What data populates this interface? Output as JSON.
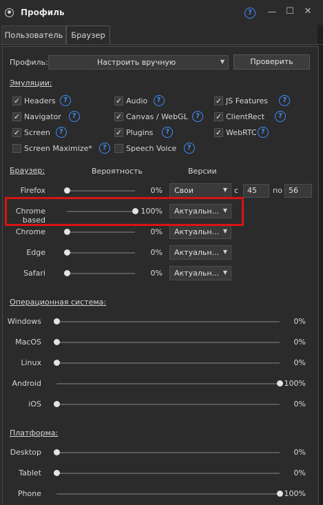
{
  "window": {
    "title": "Профиль",
    "help_icon": "help-icon"
  },
  "tabs": [
    {
      "label": "Пользователь"
    },
    {
      "label": "Браузер"
    }
  ],
  "profile": {
    "label": "Профиль:",
    "select_value": "Настроить вручную",
    "check_button": "Проверить"
  },
  "emulations": {
    "title": "Эмуляции:",
    "items": [
      {
        "label": "Headers",
        "checked": true
      },
      {
        "label": "Audio",
        "checked": true
      },
      {
        "label": "JS Features",
        "checked": true
      },
      {
        "label": "Navigator",
        "checked": true
      },
      {
        "label": "Canvas / WebGL",
        "checked": true
      },
      {
        "label": "ClientRect",
        "checked": true
      },
      {
        "label": "Screen",
        "checked": true
      },
      {
        "label": "Plugins",
        "checked": true
      },
      {
        "label": "WebRTC",
        "checked": true
      },
      {
        "label": "Screen Maximize*",
        "checked": false
      },
      {
        "label": "Speech Voice",
        "checked": false
      }
    ]
  },
  "browser": {
    "title": "Браузер:",
    "col_probability": "Вероятность",
    "col_versions": "Версии",
    "rows": [
      {
        "label": "Firefox",
        "value": 0,
        "pct": "0%",
        "version": "Свои",
        "from_label": "с",
        "from": "45",
        "to_label": "по",
        "to": "56"
      },
      {
        "label": "Chrome based",
        "value": 100,
        "pct": "100%",
        "version": "Актуальн..."
      },
      {
        "label": "Chrome",
        "value": 0,
        "pct": "0%",
        "version": "Актуальн..."
      },
      {
        "label": "Edge",
        "value": 0,
        "pct": "0%",
        "version": "Актуальн..."
      },
      {
        "label": "Safari",
        "value": 0,
        "pct": "0%",
        "version": "Актуальн..."
      }
    ]
  },
  "os": {
    "title": "Операционная система:",
    "rows": [
      {
        "label": "Windows",
        "value": 0,
        "pct": "0%"
      },
      {
        "label": "MacOS",
        "value": 0,
        "pct": "0%"
      },
      {
        "label": "Linux",
        "value": 0,
        "pct": "0%"
      },
      {
        "label": "Android",
        "value": 100,
        "pct": "100%"
      },
      {
        "label": "iOS",
        "value": 0,
        "pct": "0%"
      }
    ]
  },
  "platform": {
    "title": "Платформа:",
    "rows": [
      {
        "label": "Desktop",
        "value": 0,
        "pct": "0%"
      },
      {
        "label": "Tablet",
        "value": 0,
        "pct": "0%"
      },
      {
        "label": "Phone",
        "value": 100,
        "pct": "100%"
      }
    ]
  },
  "colors": {
    "accent": "#3f8cff",
    "highlight": "#d81414",
    "background": "#2b2b2b"
  }
}
